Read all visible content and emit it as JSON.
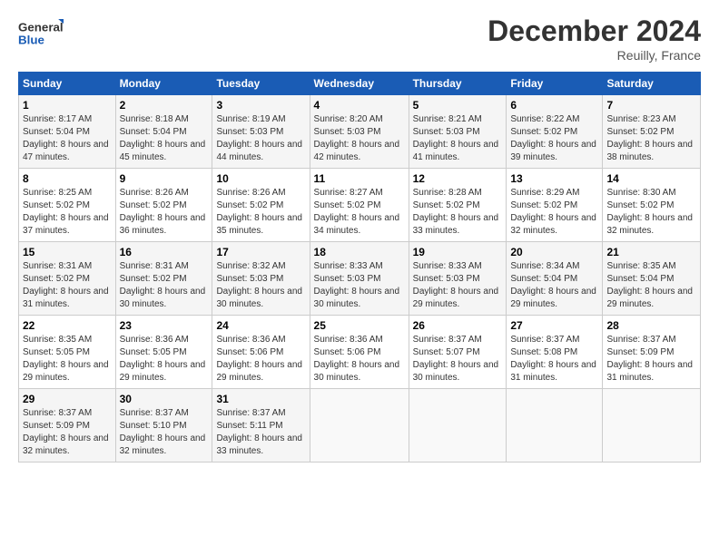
{
  "logo": {
    "line1": "General",
    "line2": "Blue"
  },
  "title": "December 2024",
  "location": "Reuilly, France",
  "days_of_week": [
    "Sunday",
    "Monday",
    "Tuesday",
    "Wednesday",
    "Thursday",
    "Friday",
    "Saturday"
  ],
  "weeks": [
    [
      {
        "day": "1",
        "sunrise": "8:17 AM",
        "sunset": "5:04 PM",
        "daylight": "8 hours and 47 minutes."
      },
      {
        "day": "2",
        "sunrise": "8:18 AM",
        "sunset": "5:04 PM",
        "daylight": "8 hours and 45 minutes."
      },
      {
        "day": "3",
        "sunrise": "8:19 AM",
        "sunset": "5:03 PM",
        "daylight": "8 hours and 44 minutes."
      },
      {
        "day": "4",
        "sunrise": "8:20 AM",
        "sunset": "5:03 PM",
        "daylight": "8 hours and 42 minutes."
      },
      {
        "day": "5",
        "sunrise": "8:21 AM",
        "sunset": "5:03 PM",
        "daylight": "8 hours and 41 minutes."
      },
      {
        "day": "6",
        "sunrise": "8:22 AM",
        "sunset": "5:02 PM",
        "daylight": "8 hours and 39 minutes."
      },
      {
        "day": "7",
        "sunrise": "8:23 AM",
        "sunset": "5:02 PM",
        "daylight": "8 hours and 38 minutes."
      }
    ],
    [
      {
        "day": "8",
        "sunrise": "8:25 AM",
        "sunset": "5:02 PM",
        "daylight": "8 hours and 37 minutes."
      },
      {
        "day": "9",
        "sunrise": "8:26 AM",
        "sunset": "5:02 PM",
        "daylight": "8 hours and 36 minutes."
      },
      {
        "day": "10",
        "sunrise": "8:26 AM",
        "sunset": "5:02 PM",
        "daylight": "8 hours and 35 minutes."
      },
      {
        "day": "11",
        "sunrise": "8:27 AM",
        "sunset": "5:02 PM",
        "daylight": "8 hours and 34 minutes."
      },
      {
        "day": "12",
        "sunrise": "8:28 AM",
        "sunset": "5:02 PM",
        "daylight": "8 hours and 33 minutes."
      },
      {
        "day": "13",
        "sunrise": "8:29 AM",
        "sunset": "5:02 PM",
        "daylight": "8 hours and 32 minutes."
      },
      {
        "day": "14",
        "sunrise": "8:30 AM",
        "sunset": "5:02 PM",
        "daylight": "8 hours and 32 minutes."
      }
    ],
    [
      {
        "day": "15",
        "sunrise": "8:31 AM",
        "sunset": "5:02 PM",
        "daylight": "8 hours and 31 minutes."
      },
      {
        "day": "16",
        "sunrise": "8:31 AM",
        "sunset": "5:02 PM",
        "daylight": "8 hours and 30 minutes."
      },
      {
        "day": "17",
        "sunrise": "8:32 AM",
        "sunset": "5:03 PM",
        "daylight": "8 hours and 30 minutes."
      },
      {
        "day": "18",
        "sunrise": "8:33 AM",
        "sunset": "5:03 PM",
        "daylight": "8 hours and 30 minutes."
      },
      {
        "day": "19",
        "sunrise": "8:33 AM",
        "sunset": "5:03 PM",
        "daylight": "8 hours and 29 minutes."
      },
      {
        "day": "20",
        "sunrise": "8:34 AM",
        "sunset": "5:04 PM",
        "daylight": "8 hours and 29 minutes."
      },
      {
        "day": "21",
        "sunrise": "8:35 AM",
        "sunset": "5:04 PM",
        "daylight": "8 hours and 29 minutes."
      }
    ],
    [
      {
        "day": "22",
        "sunrise": "8:35 AM",
        "sunset": "5:05 PM",
        "daylight": "8 hours and 29 minutes."
      },
      {
        "day": "23",
        "sunrise": "8:36 AM",
        "sunset": "5:05 PM",
        "daylight": "8 hours and 29 minutes."
      },
      {
        "day": "24",
        "sunrise": "8:36 AM",
        "sunset": "5:06 PM",
        "daylight": "8 hours and 29 minutes."
      },
      {
        "day": "25",
        "sunrise": "8:36 AM",
        "sunset": "5:06 PM",
        "daylight": "8 hours and 30 minutes."
      },
      {
        "day": "26",
        "sunrise": "8:37 AM",
        "sunset": "5:07 PM",
        "daylight": "8 hours and 30 minutes."
      },
      {
        "day": "27",
        "sunrise": "8:37 AM",
        "sunset": "5:08 PM",
        "daylight": "8 hours and 31 minutes."
      },
      {
        "day": "28",
        "sunrise": "8:37 AM",
        "sunset": "5:09 PM",
        "daylight": "8 hours and 31 minutes."
      }
    ],
    [
      {
        "day": "29",
        "sunrise": "8:37 AM",
        "sunset": "5:09 PM",
        "daylight": "8 hours and 32 minutes."
      },
      {
        "day": "30",
        "sunrise": "8:37 AM",
        "sunset": "5:10 PM",
        "daylight": "8 hours and 32 minutes."
      },
      {
        "day": "31",
        "sunrise": "8:37 AM",
        "sunset": "5:11 PM",
        "daylight": "8 hours and 33 minutes."
      },
      null,
      null,
      null,
      null
    ]
  ],
  "labels": {
    "sunrise": "Sunrise:",
    "sunset": "Sunset:",
    "daylight": "Daylight:"
  }
}
